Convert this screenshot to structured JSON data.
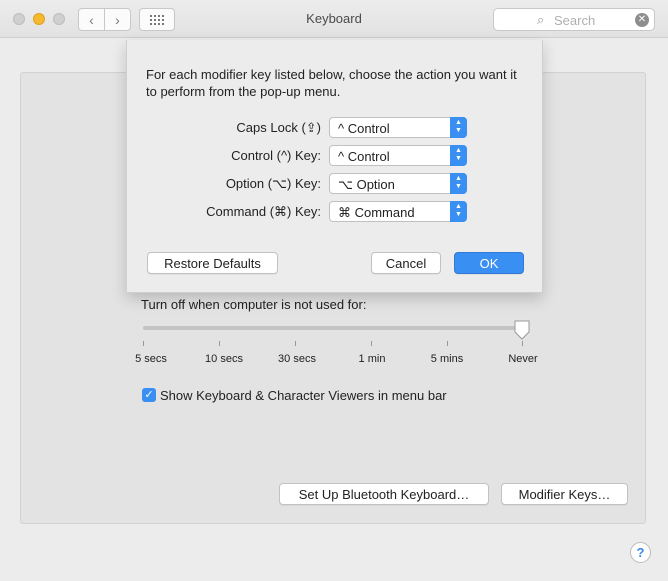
{
  "window": {
    "title": "Keyboard"
  },
  "toolbar": {
    "back_icon": "‹",
    "forward_icon": "›",
    "grid_icon": "⋮⋮⋮"
  },
  "search": {
    "placeholder": "Search",
    "icon": "⌕",
    "clear_icon": "✕"
  },
  "colors": {
    "accent": "#3a8ff2",
    "minimize": "#f5b82e"
  },
  "dialog": {
    "description": "For each modifier key listed below, choose the action you want it to perform from the pop-up menu.",
    "rows": [
      {
        "label": "Caps Lock (⇪)",
        "value": "^ Control"
      },
      {
        "label": "Control (^) Key:",
        "value": "^ Control"
      },
      {
        "label": "Option (⌥) Key:",
        "value": "⌥ Option"
      },
      {
        "label": "Command (⌘) Key:",
        "value": "⌘ Command"
      }
    ],
    "restore_label": "Restore Defaults",
    "cancel_label": "Cancel",
    "ok_label": "OK"
  },
  "backlight": {
    "turnoff_label": "Turn off when computer is not used for:",
    "ticks": [
      "5 secs",
      "10 secs",
      "30 secs",
      "1 min",
      "5 mins",
      "Never"
    ],
    "selected": "Never"
  },
  "viewer_checkbox": {
    "label": "Show Keyboard & Character Viewers in menu bar",
    "checked": true
  },
  "buttons": {
    "bluetooth": "Set Up Bluetooth Keyboard…",
    "modifier": "Modifier Keys…",
    "help": "?"
  }
}
